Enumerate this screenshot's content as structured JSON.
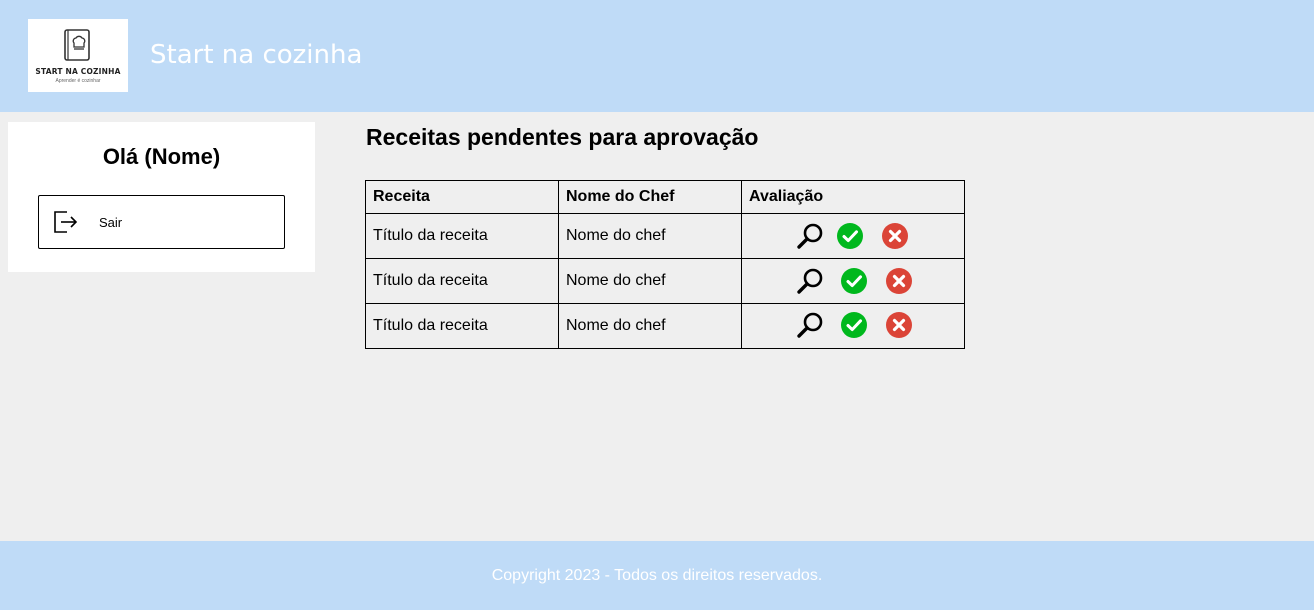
{
  "header": {
    "logo_text": "START NA COZINHA",
    "logo_subtext": "Aprender é cozinhar",
    "site_title": "Start na cozinha"
  },
  "sidebar": {
    "greeting": "Olá (Nome)",
    "logout_label": "Sair"
  },
  "main": {
    "title": "Receitas pendentes para aprovação",
    "columns": [
      "Receita",
      "Nome do Chef",
      "Avaliação"
    ],
    "rows": [
      {
        "recipe": "Título da receita",
        "chef": "Nome do chef"
      },
      {
        "recipe": "Título da receita",
        "chef": "Nome do chef"
      },
      {
        "recipe": "Título da receita",
        "chef": "Nome do chef"
      }
    ],
    "action_icons": [
      "search-icon",
      "approve-icon",
      "reject-icon"
    ]
  },
  "footer": {
    "copyright": "Copyright 2023 - Todos os direitos reservados."
  },
  "colors": {
    "header_bg": "#bfdbf7",
    "page_bg": "#efefef",
    "approve": "#00b81d",
    "reject": "#db4437"
  }
}
